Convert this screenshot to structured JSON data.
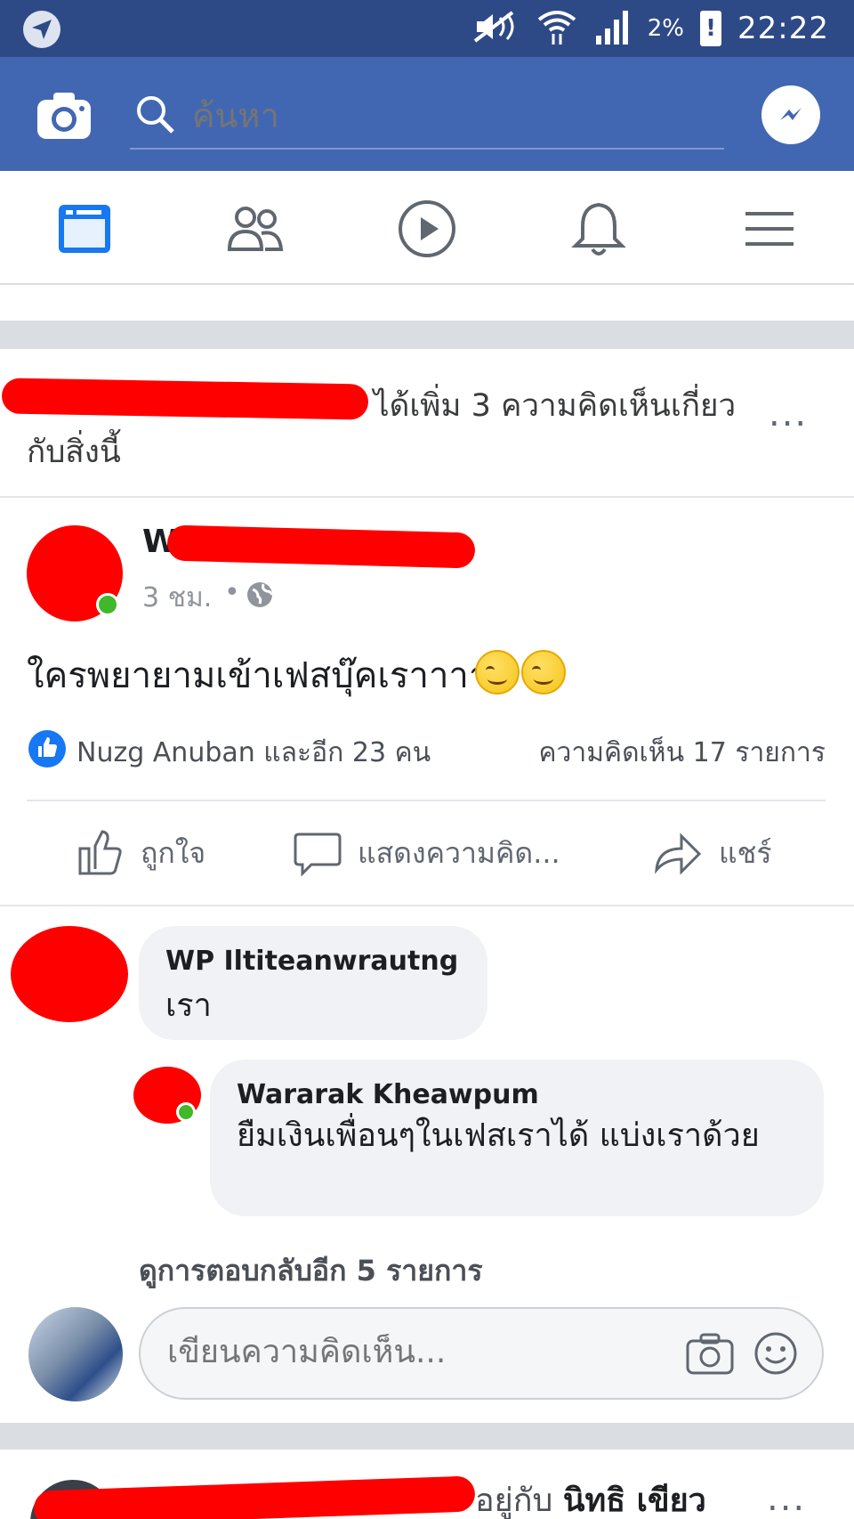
{
  "status_bar": {
    "time": "22:22",
    "battery_percent": "2%",
    "battery_warning": "!"
  },
  "app_bar": {
    "search_placeholder": "ค้นหา"
  },
  "nav_tabs": [
    {
      "name": "news-feed",
      "icon": "news-feed-icon",
      "active": true
    },
    {
      "name": "friends",
      "icon": "friends-icon",
      "active": false
    },
    {
      "name": "watch",
      "icon": "play-icon",
      "active": false
    },
    {
      "name": "notifications",
      "icon": "bell-icon",
      "active": false
    },
    {
      "name": "menu",
      "icon": "hamburger-icon",
      "active": false
    }
  ],
  "activity": {
    "text": "ได้เพิ่ม 3 ความคิดเห็นเกี่ยวกับสิ่งนี้",
    "more": "..."
  },
  "post": {
    "author_initial": "W",
    "time": "3 ชม.",
    "privacy_icon": "globe-icon",
    "text": "ใครพยายามเข้าเฟสบุ๊คเราาาา",
    "emoji": [
      "smiling-face-emoji",
      "smiling-face-emoji"
    ],
    "reactions": "Nuzg Anuban และอีก 23 คน",
    "comments_count": "ความคิดเห็น 17 รายการ",
    "actions": {
      "like": "ถูกใจ",
      "comment": "แสดงความคิด...",
      "share": "แชร์"
    }
  },
  "comments": [
    {
      "name": "WP Iltiteanwrautng",
      "text": "เรา"
    },
    {
      "name": "Wararak Kheawpum",
      "text": "ยืมเงินเพื่อนๆในเฟสเราได้ แบ่งเราด้วย"
    }
  ],
  "more_replies": "ดูการตอบกลับอีก 5 รายการ",
  "comment_input": {
    "placeholder": "เขียนความคิดเห็น..."
  },
  "next_post": {
    "with_text": "อยู่กับ",
    "tagged_name": "นิทธิ เขียว",
    "more": "..."
  },
  "colors": {
    "status_bar": "#2e4a86",
    "app_bar": "#4267b2",
    "active_tab": "#1877f2",
    "redaction": "#ff0000",
    "online": "#42b72a"
  }
}
